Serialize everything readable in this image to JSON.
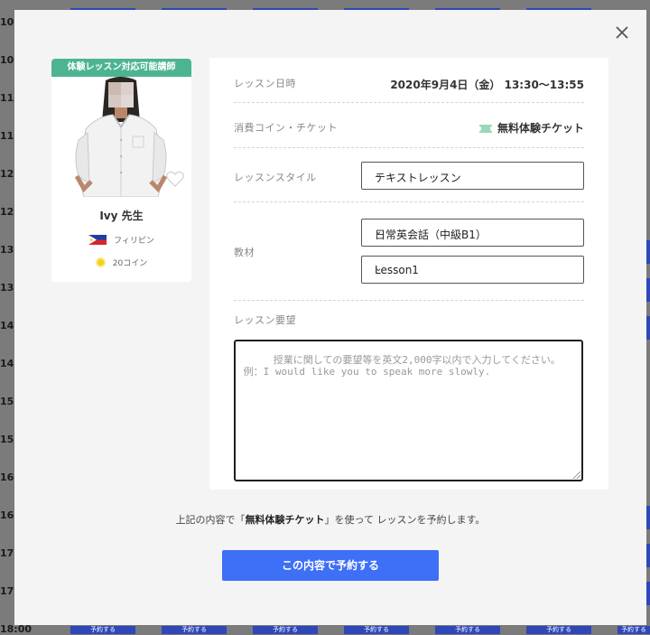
{
  "background": {
    "times": [
      "10:",
      "10:",
      "11:",
      "11:",
      "12:",
      "12:",
      "13:",
      "13:",
      "14:",
      "14:",
      "15:",
      "15:",
      "16:",
      "16:",
      "17:",
      "17:"
    ],
    "bottom_time": "18:00",
    "book_label": "予約する",
    "slot_color": "#2f47b7"
  },
  "modal": {
    "close_icon": "close-icon",
    "teacher": {
      "badge": "体験レッスン対応可能講師",
      "name": "Ivy 先生",
      "country": "フィリピン",
      "coins": "20コイン",
      "badge_color": "#4db492"
    },
    "form": {
      "date_label": "レッスン日時",
      "date_value": "2020年9月4日（金） 13:30〜13:55",
      "ticket_label": "消費コイン・チケット",
      "ticket_value": "無料体験チケット",
      "style_label": "レッスンスタイル",
      "style_value": "テキストレッスン",
      "material_label": "教材",
      "material_value": "日常英会話（中級B1）",
      "lesson_value": "Lesson1",
      "request_label": "レッスン要望",
      "request_placeholder": "授業に関しての要望等を英文2,000字以内で入力してください。\n 例：I would like you to speak more slowly."
    },
    "note_prefix": "上記の内容で「",
    "note_bold": "無料体験チケット",
    "note_suffix": "」を使って レッスンを予約します。",
    "submit_label": "この内容で予約する",
    "accent_color": "#3e6ff7"
  }
}
